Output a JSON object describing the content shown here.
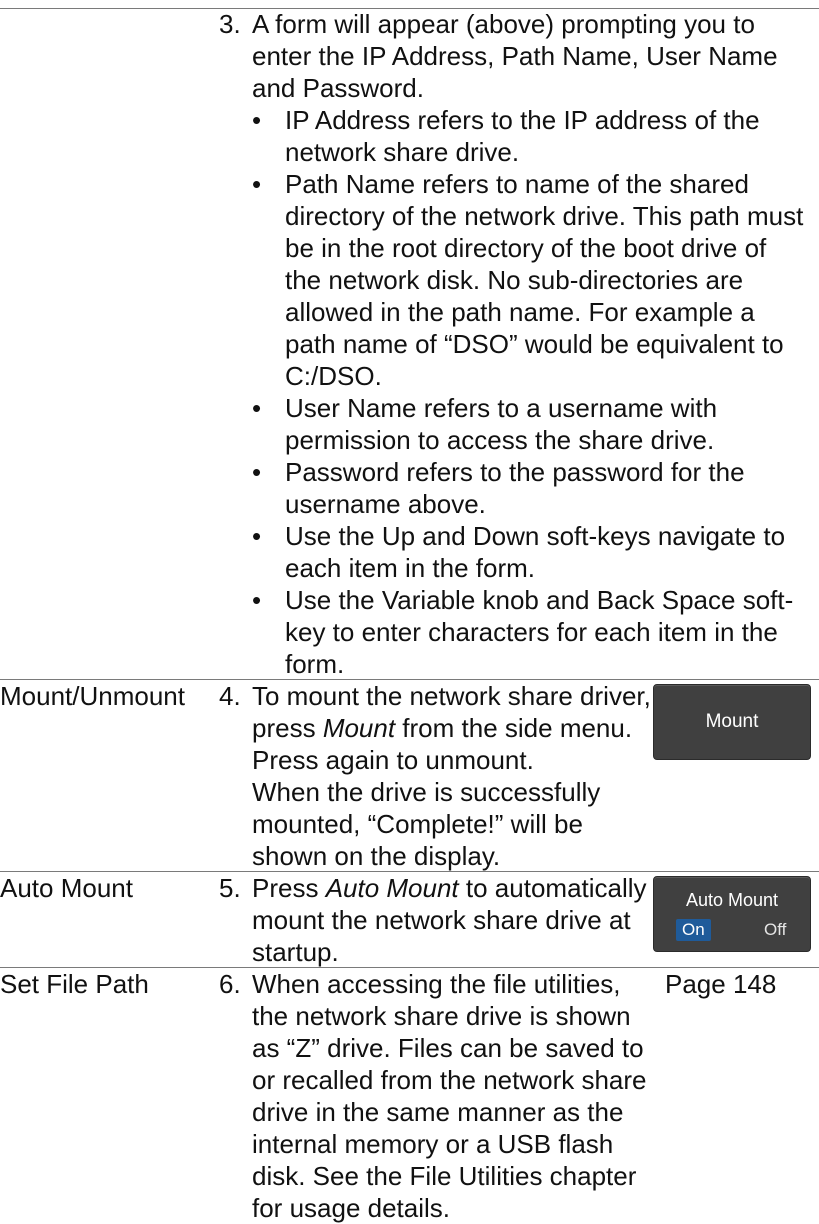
{
  "step3": {
    "number": "3.",
    "intro": [
      "A form will appear (above) prompting you to",
      "enter the IP Address, Path Name, User Name",
      "and Password."
    ],
    "bullets": [
      [
        "IP Address refers to the IP address of the",
        "network share drive."
      ],
      [
        "Path Name refers to name of the shared",
        "directory of the network drive. This path must",
        "be in the root directory of the boot drive of",
        "the network disk. No sub-directories are",
        "allowed in the path name. For example a",
        "path name of “DSO” would be equivalent to",
        "C:/DSO."
      ],
      [
        "User Name refers to a username with",
        "permission to access the share drive."
      ],
      [
        "Password refers to the password for the",
        "username above."
      ],
      [
        "Use the Up and Down soft-keys navigate to",
        "each item in the form."
      ],
      [
        "Use the Variable knob and Back Space soft-",
        "key to enter characters for each item in the",
        "form."
      ]
    ],
    "bullet_glyph": "•"
  },
  "step4": {
    "label": "Mount/Unmount",
    "number": "4.",
    "line1_prefix": "To mount the network share driver,",
    "line2_pre": "press ",
    "line2_italic": "Mount",
    "line2_post": " from the side menu.",
    "lines": [
      "Press again to unmount.",
      "When the drive is successfully",
      "mounted, “Complete!” will be",
      "shown on the display."
    ],
    "key_label": "Mount"
  },
  "step5": {
    "label": "Auto Mount",
    "number": "5.",
    "line1_pre": "Press ",
    "line1_italic": "Auto Mount",
    "line1_post": " to automatically",
    "lines": [
      "mount the network share drive at",
      "startup."
    ],
    "key_title": "Auto Mount",
    "key_on": "On",
    "key_off": "Off"
  },
  "step6": {
    "label": "Set File Path",
    "number": "6.",
    "lines": [
      "When accessing the file utilities,",
      "the network share drive is shown",
      "as “Z” drive. Files can be saved to",
      "or recalled from the network share",
      "drive in the same manner as the",
      "internal memory or a USB flash",
      "disk. See the File Utilities chapter",
      "for usage details."
    ],
    "page_ref": "Page 148"
  },
  "colors": {
    "soft_key_bg": "#404040",
    "soft_key_selected": "#1f5b9a",
    "rule": "#7a7a7a"
  }
}
